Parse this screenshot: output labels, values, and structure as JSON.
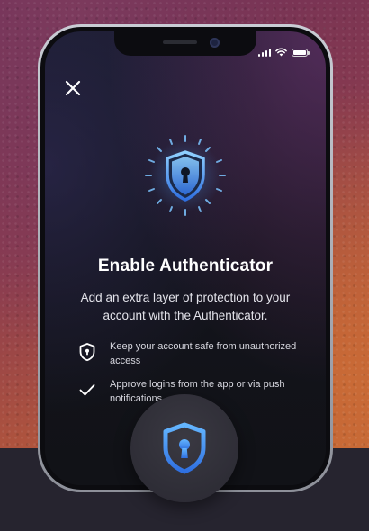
{
  "screen": {
    "title": "Enable Authenticator",
    "subtitle": "Add an extra layer of protection to your account with the Authenticator."
  },
  "features": [
    {
      "icon": "shield-lock-icon",
      "text": "Keep your account safe from unauthorized access"
    },
    {
      "icon": "checkmark-icon",
      "text": "Approve logins from the app or via push notifications"
    }
  ],
  "icons": {
    "close": "close-icon",
    "hero": "shield-keyhole-icon",
    "badge": "shield-keyhole-icon"
  },
  "colors": {
    "accent_blue": "#4da3ff",
    "shield_light": "#7cc4ff",
    "shield_dark": "#2f6fe0"
  }
}
